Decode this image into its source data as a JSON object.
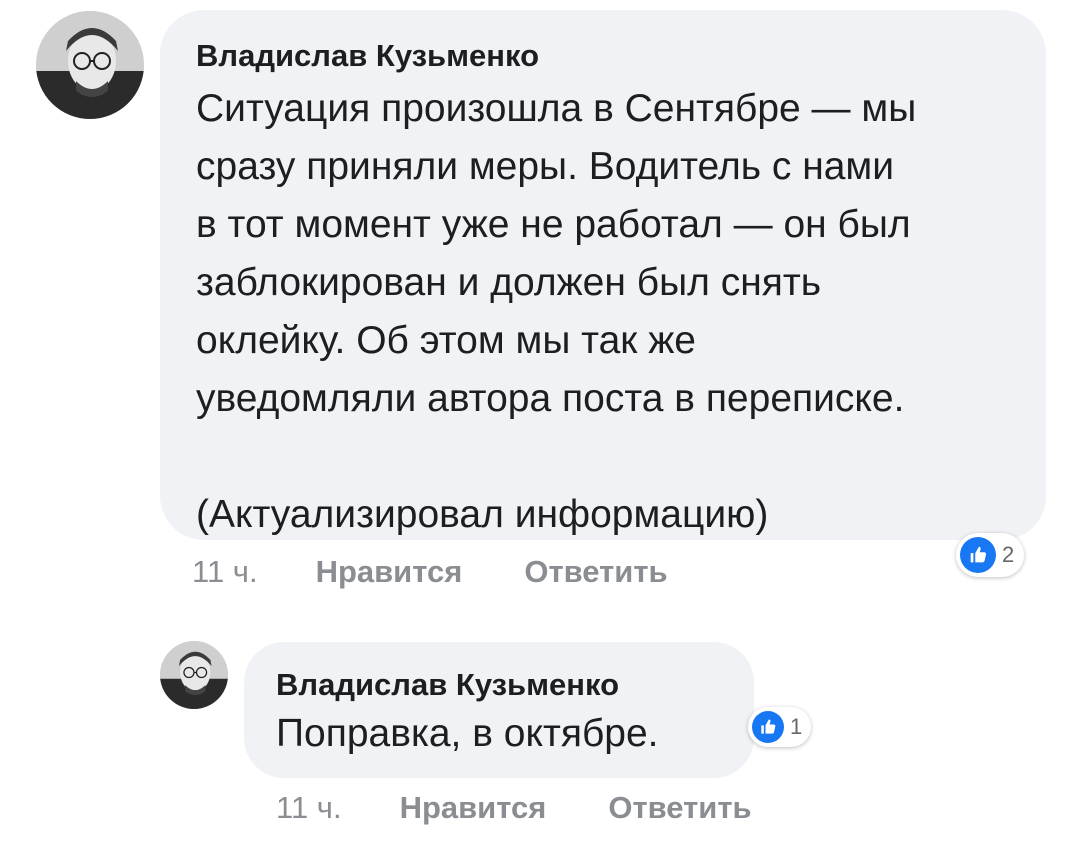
{
  "comments": [
    {
      "author": "Владислав Кузьменко",
      "text": "Ситуация произошла в Сентябре — мы\nсразу приняли меры. Водитель с нами\nв тот момент уже не работал — он был\nзаблокирован и должен был снять\nоклейку. Об этом мы так же\nуведомляли автора поста в переписке.\n\n(Актуализировал информацию)",
      "time": "11 ч.",
      "like_label": "Нравится",
      "reply_label": "Ответить",
      "reaction_count": "2",
      "reaction_icon": "like-icon",
      "accent": "#1877f2"
    },
    {
      "author": "Владислав Кузьменко",
      "text": "Поправка, в октябре.",
      "time": "11 ч.",
      "like_label": "Нравится",
      "reply_label": "Ответить",
      "reaction_count": "1",
      "reaction_icon": "like-icon",
      "accent": "#1877f2"
    }
  ]
}
